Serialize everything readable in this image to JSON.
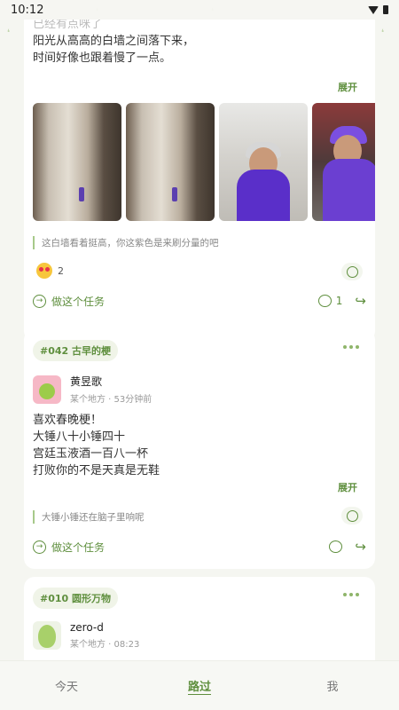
{
  "status_bar": {
    "time": "10:12"
  },
  "post1": {
    "faded_line": "已经有点咪了",
    "lines": [
      "阳光从高高的白墙之间落下来，",
      "时间好像也跟着慢了一点。"
    ],
    "expand_label": "展开",
    "quote": "这白墙看着挺高，你这紫色是来刷分量的吧",
    "reaction_count": "2",
    "do_task_label": "做这个任务",
    "comment_count": "1"
  },
  "post2": {
    "topic": "#042 古早的梗",
    "author_name": "黄昱歌",
    "author_meta": "某个地方 · 53分钟前",
    "lines": [
      "喜欢春晚梗！",
      "大锤八十小锤四十",
      "宫廷玉液酒一百八一杯",
      "打败你的不是天真是无鞋"
    ],
    "expand_label": "展开",
    "quote": "大锤小锤还在脑子里响呢",
    "do_task_label": "做这个任务"
  },
  "post3": {
    "topic": "#010 圆形万物",
    "author_name": "zero-d",
    "author_meta": "某个地方 · 08:23"
  },
  "tabs": [
    {
      "label": "今天"
    },
    {
      "label": "路过"
    },
    {
      "label": "我"
    }
  ],
  "colors": {
    "accent": "#5f8f3e",
    "background": "#f5f6f1"
  }
}
